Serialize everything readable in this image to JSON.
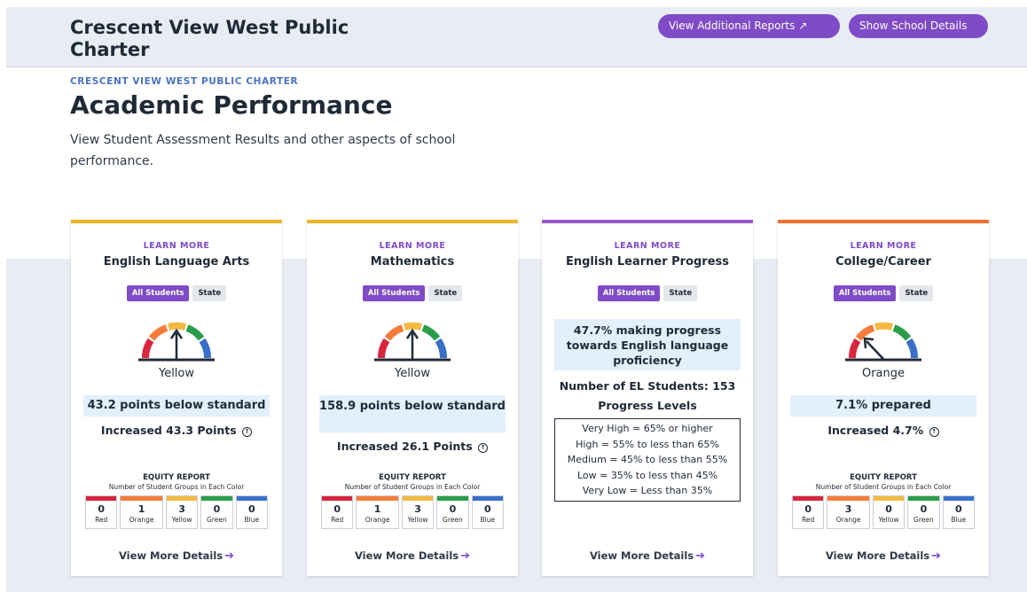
{
  "header": {
    "school_name": "Crescent View West Public Charter",
    "btn_reports": "View Additional Reports",
    "btn_details": "Show School Details"
  },
  "page": {
    "eyebrow": "CRESCENT VIEW WEST PUBLIC CHARTER",
    "title": "Academic Performance",
    "description": "View Student Assessment Results and other aspects of school performance."
  },
  "cards": [
    {
      "learn": "LEARN MORE",
      "title": "English Language Arts",
      "toggle": [
        "All Students",
        "State"
      ],
      "level": "Yellow",
      "metric": "43.2 points below standard",
      "change": "Increased 43.3 Points",
      "equity_title": "EQUITY REPORT",
      "equity_sub": "Number of Student Groups in Each Color",
      "equity": [
        {
          "label": "Red",
          "count": "0"
        },
        {
          "label": "Orange",
          "count": "1"
        },
        {
          "label": "Yellow",
          "count": "3"
        },
        {
          "label": "Green",
          "count": "0"
        },
        {
          "label": "Blue",
          "count": "0"
        }
      ],
      "more": "View More Details"
    },
    {
      "learn": "LEARN MORE",
      "title": "Mathematics",
      "toggle": [
        "All Students",
        "State"
      ],
      "level": "Yellow",
      "metric": "158.9 points below standard",
      "change": "Increased 26.1 Points",
      "equity_title": "EQUITY REPORT",
      "equity_sub": "Number of Student Groups in Each Color",
      "equity": [
        {
          "label": "Red",
          "count": "0"
        },
        {
          "label": "Orange",
          "count": "1"
        },
        {
          "label": "Yellow",
          "count": "3"
        },
        {
          "label": "Green",
          "count": "0"
        },
        {
          "label": "Blue",
          "count": "0"
        }
      ],
      "more": "View More Details"
    },
    {
      "learn": "LEARN MORE",
      "title": "English Learner Progress",
      "toggle": [
        "All Students",
        "State"
      ],
      "progress_text": "47.7% making progress towards English language proficiency",
      "el_count": "Number of EL Students: 153",
      "levels_title": "Progress Levels",
      "levels": [
        "Very High = 65% or higher",
        "High = 55% to less than 65%",
        "Medium = 45% to less than 55%",
        "Low = 35% to less than 45%",
        "Very Low = Less than 35%"
      ],
      "more": "View More Details"
    },
    {
      "learn": "LEARN MORE",
      "title": "College/Career",
      "toggle": [
        "All Students",
        "State"
      ],
      "level": "Orange",
      "metric": "7.1% prepared",
      "change": "Increased 4.7%",
      "equity_title": "EQUITY REPORT",
      "equity_sub": "Number of Student Groups in Each Color",
      "equity": [
        {
          "label": "Red",
          "count": "0"
        },
        {
          "label": "Orange",
          "count": "3"
        },
        {
          "label": "Yellow",
          "count": "0"
        },
        {
          "label": "Green",
          "count": "0"
        },
        {
          "label": "Blue",
          "count": "0"
        }
      ],
      "more": "View More Details"
    }
  ],
  "colors": {
    "accent": "#7f4bc7",
    "red": "#d7263d",
    "orange": "#f57c3a",
    "yellow": "#f4b942",
    "green": "#2a9d4a",
    "blue": "#3a6fc9"
  },
  "icons": [
    "external-link-icon",
    "arrow-up-circle-icon",
    "arrow-right-icon",
    "gauge-icon"
  ]
}
